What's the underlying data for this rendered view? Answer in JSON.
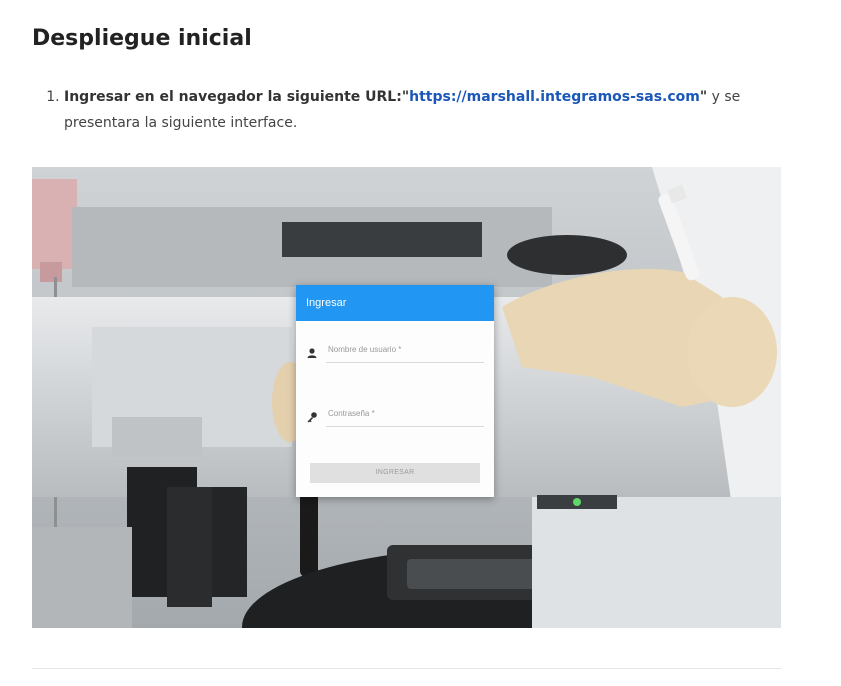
{
  "article": {
    "section_title": "Despliegue inicial",
    "steps": [
      {
        "number": "1.",
        "bold_text": "Ingresar en el navegador la siguiente URL:",
        "quote_open": "\"",
        "url_text": "https://marshall.integramos-sas.com",
        "quote_close": "\"",
        "rest_text": " y se presentara la siguiente interface."
      }
    ]
  },
  "screenshot": {
    "login_card": {
      "header_title": "Ingresar",
      "username_placeholder": "Nombre de usuario *",
      "password_placeholder": "Contraseña *",
      "submit_label": "INGRESAR",
      "header_color": "#2196f3"
    },
    "icons": {
      "username": "user-icon",
      "password": "key-icon"
    }
  },
  "colors": {
    "link": "#1a57b8",
    "title": "#222222"
  }
}
